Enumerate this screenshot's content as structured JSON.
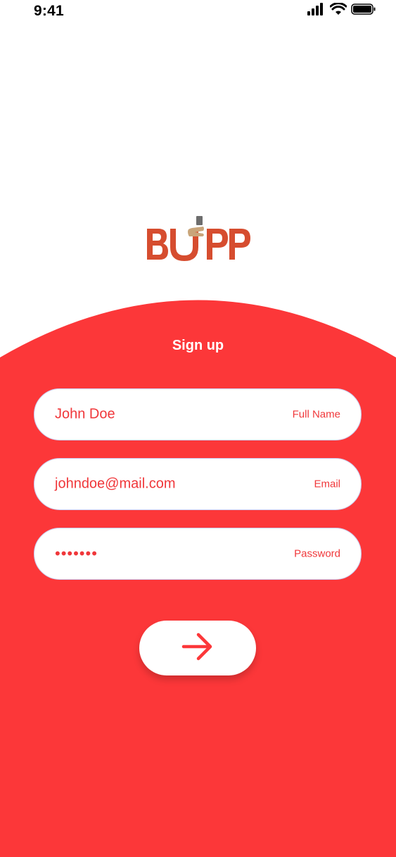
{
  "status_bar": {
    "time": "9:41",
    "icons": [
      "signal-icon",
      "wifi-icon",
      "battery-icon"
    ]
  },
  "logo": {
    "text": "BUPP",
    "icon_name": "bupp-logo-icon"
  },
  "form": {
    "title": "Sign up",
    "fields": [
      {
        "value": "John Doe",
        "label": "Full Name"
      },
      {
        "value": "johndoe@mail.com",
        "label": "Email"
      },
      {
        "value": "•••••••",
        "label": "Password"
      }
    ],
    "submit_icon": "arrow-right-icon"
  },
  "colors": {
    "accent": "#fc3739",
    "field_text": "#f0373a",
    "logo_primary": "#d64d2f",
    "logo_secondary": "#c9a57a"
  }
}
